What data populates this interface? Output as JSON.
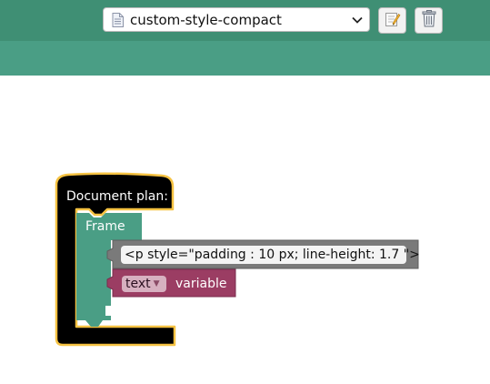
{
  "toolbar": {
    "file_select_value": "custom-style-compact",
    "icons": {
      "file": "document-icon",
      "dropdown": "chevron-down-icon",
      "edit": "edit-icon",
      "delete": "trash-icon"
    }
  },
  "workspace": {
    "document_plan": {
      "label": "Document plan:"
    },
    "frame": {
      "label": "Frame"
    },
    "html_block": {
      "code": "<p style=\"padding : 10 px; line-height: 1.7 \">"
    },
    "variable_block": {
      "dropdown_value": "text",
      "label": "variable"
    }
  },
  "colors": {
    "header": "#3f8f74",
    "subheader": "#4a9e85",
    "document_plan_block": "#000000",
    "selection_outline": "#f5c242",
    "frame_block": "#4a9e85",
    "html_block": "#7a7a7a",
    "variable_block": "#9b3d63"
  }
}
